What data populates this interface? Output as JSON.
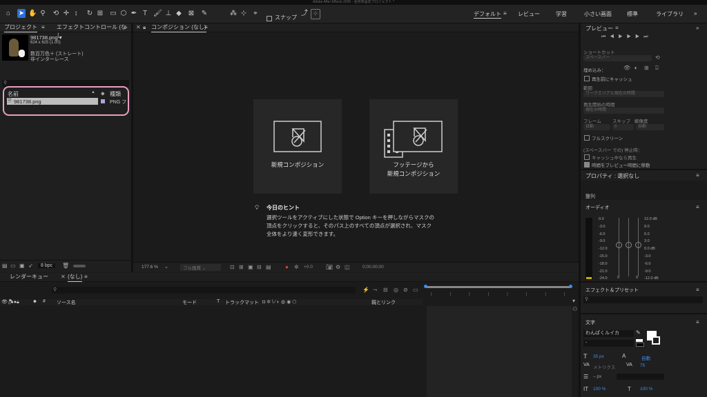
{
  "window_title": "Adobe After Effects 2026 - 名称未設定プロジェクト *",
  "toolbar": {
    "snap_label": "スナップ",
    "workspaces": [
      "デフォルト",
      "レビュー",
      "学習",
      "小さい画面",
      "標準",
      "ライブラリ"
    ],
    "menu_glyph": "≡",
    "more_glyph": "»"
  },
  "project": {
    "tabs": [
      "プロジェクト",
      "エフェクトコントロール (なし"
    ],
    "file_name": "981738.png ▾",
    "dimensions": "624 x 625 (1.00)",
    "color": "数百万色＋ (ストレート)",
    "interlace": "非インターレース",
    "search_placeholder": "",
    "col_name": "名前",
    "col_type": "種類",
    "row_name": "981738.png",
    "row_type": "PNG フ",
    "bpc": "8 bpc"
  },
  "composition": {
    "tab": "コンポジション (なし)",
    "card1": "新規コンポジション",
    "card2_line1": "フッテージから",
    "card2_line2": "新規コンポジション",
    "tip_title": "今日のヒント",
    "tip_line1": "選択ツールをアクティブにした状態で Option キーを押しながらマスクの",
    "tip_line2": "頂点をクリックすると、そのパス上のすべての頂点が選択され、マスク",
    "tip_line3": "全体をより速く変形できます。",
    "zoom": "177.6 %",
    "quality": "フル画質",
    "exposure": "+0.0",
    "timecode": "0;00;00;00"
  },
  "timeline": {
    "tabs": [
      "レンダーキュー",
      "(なし)"
    ],
    "col_source": "ソース名",
    "col_mode": "モード",
    "col_t": "T",
    "col_track": "トラックマット",
    "col_parent": "親とリンク"
  },
  "preview": {
    "title": "プレビュー",
    "shortcut_label": "ショートカット",
    "shortcut_value": "スペースバー",
    "embed_label": "埋め込み：",
    "cache_before": "再生前にキャッシュ",
    "range_label": "範囲",
    "range_value": "ワークエリアと現在の時間",
    "start_label": "再生開始の時間",
    "start_value": "現在の時間",
    "frame_label": "フレーム",
    "skip_label": "スキップ",
    "res_label": "解像度",
    "frame_value": "自動",
    "skip_value": "0",
    "res_value": "自動",
    "fullscreen": "フルスクリーン",
    "stop_label": "(スペースバー での) 停止時：",
    "stop_cache": "キャッシュ中なら再生",
    "stop_move": "時間をプレビュー時間に移動"
  },
  "properties": {
    "title": "プロパティ : 選択なし",
    "align": "整列"
  },
  "audio": {
    "title": "オーディオ",
    "left_scale": [
      "0.0",
      "-3.0",
      "-6.0",
      "-9.0",
      "-12.0",
      "-15.0",
      "-18.0",
      "-21.0",
      "-24.0"
    ],
    "right_scale": [
      "12.0 dB",
      "9.0",
      "6.0",
      "3.0",
      "0.0 dB",
      "-3.0",
      "-6.0",
      "-9.0",
      "-12.0 dB"
    ],
    "knob_values": [
      "0",
      "0"
    ]
  },
  "effects": {
    "title": "エフェクト＆プリセット"
  },
  "character": {
    "title": "文字",
    "font": "わんぱくルイカ",
    "style": "-",
    "size": "35 px",
    "leading": "自動",
    "kerning": "メトリクス",
    "tracking": "75",
    "stroke": "– px",
    "vscale": "100 %",
    "hscale": "100 %"
  },
  "colors": {
    "accent": "#2d6fd6",
    "link_blue": "#3c8ef0",
    "pink_annotation": "#e8a0c0"
  }
}
